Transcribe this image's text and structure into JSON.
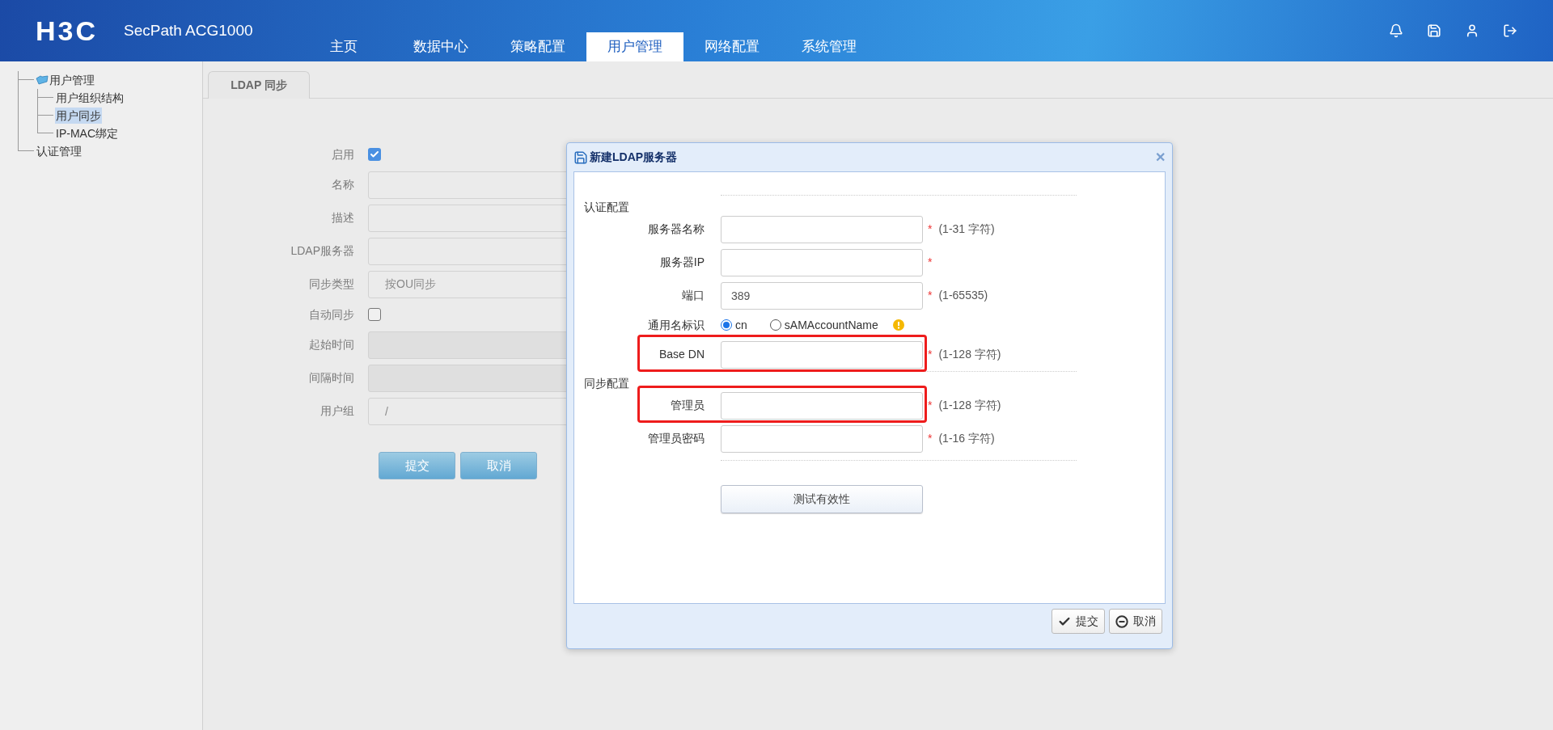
{
  "header": {
    "logo": "H3C",
    "product": "SecPath ACG1000",
    "nav": [
      {
        "label": "主页",
        "selected": false
      },
      {
        "label": "数据中心",
        "selected": false
      },
      {
        "label": "策略配置",
        "selected": false
      },
      {
        "label": "用户管理",
        "selected": true
      },
      {
        "label": "网络配置",
        "selected": false
      },
      {
        "label": "系统管理",
        "selected": false
      }
    ]
  },
  "sidebar": {
    "tree": [
      {
        "label": "用户管理",
        "selected": false,
        "children": [
          {
            "label": "用户组织结构",
            "selected": false
          },
          {
            "label": "用户同步",
            "selected": true
          },
          {
            "label": "IP-MAC绑定",
            "selected": false
          }
        ]
      },
      {
        "label": "认证管理",
        "selected": false
      }
    ]
  },
  "tabs": [
    {
      "label": "LDAP 同步",
      "selected": true
    }
  ],
  "form": {
    "fields": [
      {
        "kind": "checkbox",
        "label": "启用",
        "checked": true
      },
      {
        "kind": "input",
        "label": "名称",
        "disabled": false
      },
      {
        "kind": "input",
        "label": "描述",
        "disabled": false
      },
      {
        "kind": "input",
        "label": "LDAP服务器",
        "disabled": false
      },
      {
        "kind": "input",
        "label": "同步类型",
        "value": "按OU同步",
        "disabled": false
      },
      {
        "kind": "checkbox",
        "label": "自动同步",
        "checked": false
      },
      {
        "kind": "input",
        "label": "起始时间",
        "disabled": true
      },
      {
        "kind": "input",
        "label": "间隔时间",
        "disabled": true
      },
      {
        "kind": "input",
        "label": "用户组",
        "value": "/",
        "disabled": false
      }
    ],
    "buttons": [
      "提交",
      "取消"
    ]
  },
  "dialog": {
    "title": "新建LDAP服务器",
    "close": "✕",
    "sections": [
      {
        "title": "认证配置",
        "rows": [
          {
            "kind": "input",
            "label": "服务器名称",
            "required_mark": "*",
            "hint": "(1-31 字符)"
          },
          {
            "kind": "input",
            "label": "服务器IP",
            "required_mark": "*"
          },
          {
            "kind": "input",
            "label": "端口",
            "value": "389",
            "required_mark": "*",
            "hint": "(1-65535)"
          },
          {
            "kind": "radio",
            "label": "通用名标识",
            "options": [
              {
                "label": "cn",
                "selected": true
              },
              {
                "label": "sAMAccountName",
                "selected": false
              }
            ]
          },
          {
            "kind": "input",
            "label": "Base DN",
            "required_mark": "*",
            "hint": "(1-128 字符)",
            "highlighted": true
          }
        ]
      },
      {
        "title": "同步配置",
        "rows": [
          {
            "kind": "input",
            "label": "管理员",
            "required_mark": "*",
            "hint": "(1-128 字符)",
            "highlighted": true
          },
          {
            "kind": "input",
            "label": "管理员密码",
            "required_mark": "*",
            "hint": "(1-16 字符)"
          }
        ]
      }
    ],
    "test_button": "测试有效性",
    "footer_buttons": [
      {
        "kind": "submit",
        "label": "提交"
      },
      {
        "kind": "cancel",
        "label": "取消"
      }
    ]
  }
}
